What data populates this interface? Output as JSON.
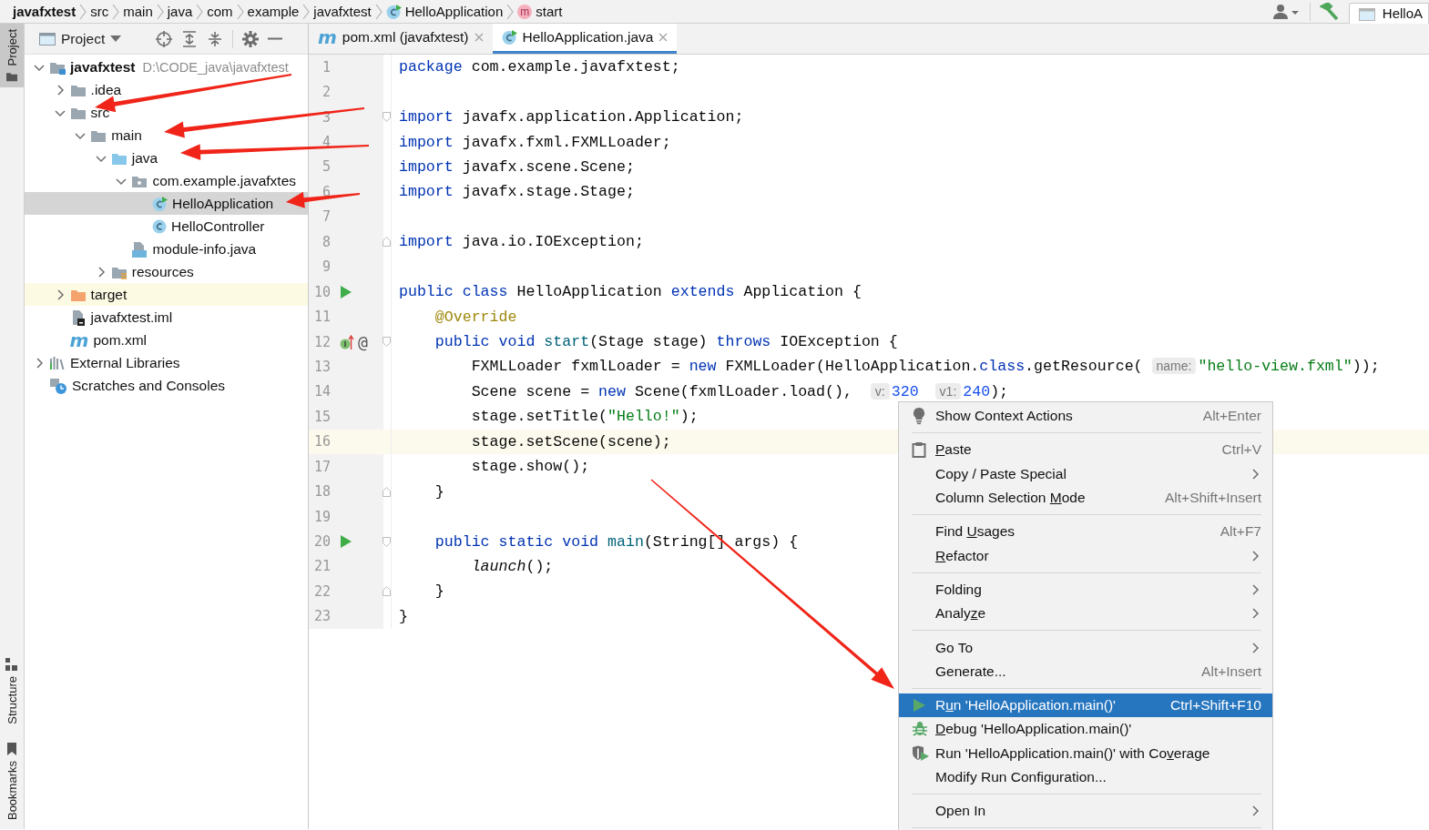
{
  "breadcrumbs": [
    {
      "label": "javafxtest",
      "kind": "project"
    },
    {
      "label": "src",
      "kind": "folder"
    },
    {
      "label": "main",
      "kind": "folder"
    },
    {
      "label": "java",
      "kind": "folder"
    },
    {
      "label": "com",
      "kind": "folder"
    },
    {
      "label": "example",
      "kind": "folder"
    },
    {
      "label": "javafxtest",
      "kind": "folder"
    },
    {
      "label": "HelloApplication",
      "kind": "class"
    },
    {
      "label": "start",
      "kind": "method",
      "glyph": "m"
    }
  ],
  "run_config": {
    "label": "HelloA"
  },
  "tool_stripe": {
    "top": [
      {
        "label": "Project",
        "selected": true
      }
    ],
    "bottom": [
      {
        "label": "Structure",
        "selected": false
      },
      {
        "label": "Bookmarks",
        "selected": false
      }
    ]
  },
  "project_panel": {
    "title": "Project",
    "tree": [
      {
        "label": "javafxtest",
        "detail": "D:\\CODE_java\\javafxtest",
        "kind": "module-folder",
        "expanded": true,
        "selected": false,
        "highlighted": false,
        "children": [
          {
            "label": ".idea",
            "kind": "folder",
            "expanded": false,
            "selected": false,
            "highlighted": false
          },
          {
            "label": "src",
            "kind": "folder",
            "expanded": true,
            "selected": false,
            "highlighted": false,
            "children": [
              {
                "label": "main",
                "kind": "folder",
                "expanded": true,
                "selected": false,
                "highlighted": false,
                "children": [
                  {
                    "label": "java",
                    "kind": "source-folder",
                    "expanded": true,
                    "selected": false,
                    "highlighted": false,
                    "children": [
                      {
                        "label": "com.example.javafxtes",
                        "kind": "package",
                        "expanded": true,
                        "selected": false,
                        "highlighted": false,
                        "children": [
                          {
                            "label": "HelloApplication",
                            "kind": "class-run",
                            "selected": true,
                            "highlighted": false
                          },
                          {
                            "label": "HelloController",
                            "kind": "class",
                            "selected": false,
                            "highlighted": false
                          }
                        ]
                      },
                      {
                        "label": "module-info.java",
                        "kind": "module-info",
                        "selected": false,
                        "highlighted": false
                      }
                    ]
                  },
                  {
                    "label": "resources",
                    "kind": "resources-folder",
                    "expanded": false,
                    "selected": false,
                    "highlighted": false
                  }
                ]
              }
            ]
          },
          {
            "label": "target",
            "kind": "excluded-folder",
            "expanded": false,
            "selected": false,
            "highlighted": true
          },
          {
            "label": "javafxtest.iml",
            "kind": "iml-file",
            "selected": false,
            "highlighted": false
          },
          {
            "label": "pom.xml",
            "kind": "maven",
            "glyph": "m",
            "selected": false,
            "highlighted": false
          }
        ]
      },
      {
        "label": "External Libraries",
        "kind": "libraries",
        "expanded": false,
        "selected": false,
        "highlighted": false
      },
      {
        "label": "Scratches and Consoles",
        "kind": "scratches",
        "selected": false,
        "highlighted": false
      }
    ]
  },
  "editor": {
    "tabs": [
      {
        "label": "pom.xml (javafxtest)",
        "kind": "maven",
        "glyph": "m",
        "selected": false
      },
      {
        "label": "HelloApplication.java",
        "kind": "class-run",
        "selected": true
      }
    ],
    "lines": [
      {
        "number": "1",
        "current": false,
        "tokens": [
          {
            "kind": "kw",
            "text": "package"
          },
          {
            "kind": "plain",
            "text": " com.example.javafxtest;"
          }
        ]
      },
      {
        "number": "2",
        "current": false
      },
      {
        "number": "3",
        "current": false,
        "fold": {
          "kind": "start"
        },
        "tokens": [
          {
            "kind": "kw",
            "text": "import"
          },
          {
            "kind": "plain",
            "text": " javafx.application.Application;"
          }
        ]
      },
      {
        "number": "4",
        "current": false,
        "tokens": [
          {
            "kind": "kw",
            "text": "import"
          },
          {
            "kind": "plain",
            "text": " javafx.fxml.FXMLLoader;"
          }
        ]
      },
      {
        "number": "5",
        "current": false,
        "tokens": [
          {
            "kind": "kw",
            "text": "import"
          },
          {
            "kind": "plain",
            "text": " javafx.scene.Scene;"
          }
        ]
      },
      {
        "number": "6",
        "current": false,
        "tokens": [
          {
            "kind": "kw",
            "text": "import"
          },
          {
            "kind": "plain",
            "text": " javafx.stage.Stage;"
          }
        ]
      },
      {
        "number": "7",
        "current": false
      },
      {
        "number": "8",
        "current": false,
        "fold": {
          "kind": "end"
        },
        "tokens": [
          {
            "kind": "kw",
            "text": "import"
          },
          {
            "kind": "plain",
            "text": " java.io.IOException;"
          }
        ]
      },
      {
        "number": "9",
        "current": false
      },
      {
        "number": "10",
        "current": false,
        "gutter": [
          {
            "kind": "run"
          }
        ],
        "tokens": [
          {
            "kind": "kw",
            "text": "public class"
          },
          {
            "kind": "plain",
            "text": " HelloApplication "
          },
          {
            "kind": "kw",
            "text": "extends"
          },
          {
            "kind": "plain",
            "text": " Application {"
          }
        ]
      },
      {
        "number": "11",
        "current": false,
        "tokens": [
          {
            "kind": "ann",
            "text": "    @Override"
          }
        ]
      },
      {
        "number": "12",
        "current": false,
        "gutter": [
          {
            "kind": "override"
          },
          {
            "kind": "text",
            "text": "@"
          }
        ],
        "fold": {
          "kind": "start"
        },
        "tokens": [
          {
            "kind": "kw",
            "text": "    public void "
          },
          {
            "kind": "fn",
            "text": "start"
          },
          {
            "kind": "plain",
            "text": "(Stage stage) "
          },
          {
            "kind": "kw",
            "text": "throws"
          },
          {
            "kind": "plain",
            "text": " IOException {"
          }
        ]
      },
      {
        "number": "13",
        "current": false,
        "tokens": [
          {
            "kind": "plain",
            "text": "        FXMLLoader fxmlLoader = "
          },
          {
            "kind": "kw",
            "text": "new"
          },
          {
            "kind": "plain",
            "text": " FXMLLoader(HelloApplication."
          },
          {
            "kind": "kw",
            "text": "class"
          },
          {
            "kind": "plain",
            "text": ".getResource( "
          },
          {
            "kind": "hint",
            "text": "name:"
          },
          {
            "kind": "str",
            "text": "\"hello-view.fxml\""
          },
          {
            "kind": "plain",
            "text": "));"
          }
        ]
      },
      {
        "number": "14",
        "current": false,
        "tokens": [
          {
            "kind": "plain",
            "text": "        Scene scene = "
          },
          {
            "kind": "kw",
            "text": "new"
          },
          {
            "kind": "plain",
            "text": " Scene(fxmlLoader.load(),  "
          },
          {
            "kind": "hint",
            "text": "v:"
          },
          {
            "kind": "num",
            "text": "320"
          },
          {
            "kind": "hint",
            "text": "v1:"
          },
          {
            "kind": "num",
            "text": "240"
          },
          {
            "kind": "plain",
            "text": ");"
          }
        ]
      },
      {
        "number": "15",
        "current": false,
        "tokens": [
          {
            "kind": "plain",
            "text": "        stage.setTitle("
          },
          {
            "kind": "str",
            "text": "\"Hello!\""
          },
          {
            "kind": "plain",
            "text": ");"
          }
        ]
      },
      {
        "number": "16",
        "current": true,
        "tokens": [
          {
            "kind": "plain",
            "text": "        stage.setScene(scene);"
          }
        ]
      },
      {
        "number": "17",
        "current": false,
        "tokens": [
          {
            "kind": "plain",
            "text": "        stage.show();"
          }
        ]
      },
      {
        "number": "18",
        "current": false,
        "fold": {
          "kind": "end"
        },
        "tokens": [
          {
            "kind": "plain",
            "text": "    }"
          }
        ]
      },
      {
        "number": "19",
        "current": false
      },
      {
        "number": "20",
        "current": false,
        "gutter": [
          {
            "kind": "run"
          }
        ],
        "fold": {
          "kind": "start"
        },
        "tokens": [
          {
            "kind": "kw",
            "text": "    public static void "
          },
          {
            "kind": "fn",
            "text": "main"
          },
          {
            "kind": "plain",
            "text": "(String[] args) {"
          }
        ]
      },
      {
        "number": "21",
        "current": false,
        "tokens": [
          {
            "kind": "italic",
            "text": "        launch"
          },
          {
            "kind": "plain",
            "text": "();"
          }
        ]
      },
      {
        "number": "22",
        "current": false,
        "fold": {
          "kind": "end"
        },
        "tokens": [
          {
            "kind": "plain",
            "text": "    }"
          }
        ]
      },
      {
        "number": "23",
        "current": false,
        "tokens": [
          {
            "kind": "plain",
            "text": "}"
          }
        ]
      }
    ]
  },
  "context_menu": [
    {
      "kind": "item",
      "icon": {
        "kind": "bulb"
      },
      "label": "Show Context Actions",
      "shortcut": "Alt+Enter",
      "submenu": false,
      "selected": false
    },
    {
      "kind": "separator"
    },
    {
      "kind": "item",
      "icon": {
        "kind": "clipboard"
      },
      "label": [
        {
          "text": "P",
          "underlined": true
        },
        {
          "text": "aste",
          "underlined": false
        }
      ],
      "shortcut": "Ctrl+V",
      "submenu": false,
      "selected": false
    },
    {
      "kind": "item",
      "label": "Copy / Paste Special",
      "submenu": true,
      "selected": false
    },
    {
      "kind": "item",
      "label": [
        {
          "text": "Column Selection ",
          "underlined": false
        },
        {
          "text": "M",
          "underlined": true
        },
        {
          "text": "ode",
          "underlined": false
        }
      ],
      "shortcut": "Alt+Shift+Insert",
      "submenu": false,
      "selected": false
    },
    {
      "kind": "separator"
    },
    {
      "kind": "item",
      "label": [
        {
          "text": "Find ",
          "underlined": false
        },
        {
          "text": "U",
          "underlined": true
        },
        {
          "text": "sages",
          "underlined": false
        }
      ],
      "shortcut": "Alt+F7",
      "submenu": false,
      "selected": false
    },
    {
      "kind": "item",
      "label": [
        {
          "text": "R",
          "underlined": true
        },
        {
          "text": "efactor",
          "underlined": false
        }
      ],
      "submenu": true,
      "selected": false
    },
    {
      "kind": "separator"
    },
    {
      "kind": "item",
      "label": "Folding",
      "submenu": true,
      "selected": false
    },
    {
      "kind": "item",
      "label": [
        {
          "text": "Analy",
          "underlined": false
        },
        {
          "text": "z",
          "underlined": true
        },
        {
          "text": "e",
          "underlined": false
        }
      ],
      "submenu": true,
      "selected": false
    },
    {
      "kind": "separator"
    },
    {
      "kind": "item",
      "label": "Go To",
      "submenu": true,
      "selected": false
    },
    {
      "kind": "item",
      "label": "Generate...",
      "shortcut": "Alt+Insert",
      "submenu": false,
      "selected": false
    },
    {
      "kind": "separator"
    },
    {
      "kind": "item",
      "icon": {
        "kind": "run"
      },
      "label": [
        {
          "text": "R",
          "underlined": false
        },
        {
          "text": "u",
          "underlined": true
        },
        {
          "text": "n 'HelloApplication.main()'",
          "underlined": false
        }
      ],
      "shortcut": "Ctrl+Shift+F10",
      "submenu": false,
      "selected": true
    },
    {
      "kind": "item",
      "icon": {
        "kind": "bug"
      },
      "label": [
        {
          "text": "D",
          "underlined": true
        },
        {
          "text": "ebug 'HelloApplication.main()'",
          "underlined": false
        }
      ],
      "submenu": false,
      "selected": false
    },
    {
      "kind": "item",
      "icon": {
        "kind": "coverage"
      },
      "label": [
        {
          "text": "Run 'HelloApplication.main()' with Co",
          "underlined": false
        },
        {
          "text": "v",
          "underlined": true
        },
        {
          "text": "erage",
          "underlined": false
        }
      ],
      "submenu": false,
      "selected": false
    },
    {
      "kind": "item",
      "label": "Modify Run Configuration...",
      "submenu": false,
      "selected": false
    },
    {
      "kind": "separator"
    },
    {
      "kind": "item",
      "label": "Open In",
      "submenu": true,
      "selected": false
    },
    {
      "kind": "separator"
    }
  ]
}
